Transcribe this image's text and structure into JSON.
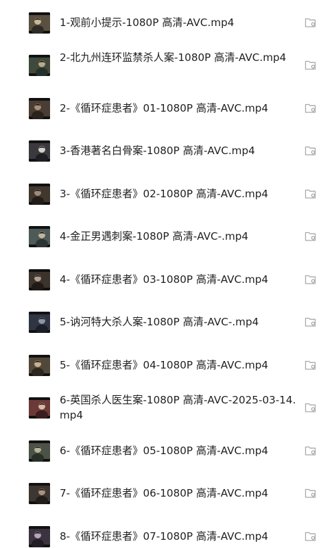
{
  "files": [
    {
      "name": "1-观前小提示-1080P 高清-AVC.mp4",
      "thumb": "intro-thumbnail"
    },
    {
      "name": "2-北九州连环监禁杀人案-1080P 高清-AVC.mp4",
      "thumb": "kitakyushu-thumbnail"
    },
    {
      "name": "2-《循环症患者》01-1080P 高清-AVC.mp4",
      "thumb": "loop-ep01-thumbnail"
    },
    {
      "name": "3-香港著名白骨案-1080P 高清-AVC.mp4",
      "thumb": "hongkong-thumbnail"
    },
    {
      "name": "3-《循环症患者》02-1080P 高清-AVC.mp4",
      "thumb": "loop-ep02-thumbnail"
    },
    {
      "name": "4-金正男遇刺案-1080P 高清-AVC-.mp4",
      "thumb": "kim-jong-nam-thumbnail"
    },
    {
      "name": "4-《循环症患者》03-1080P 高清-AVC.mp4",
      "thumb": "loop-ep03-thumbnail"
    },
    {
      "name": "5-讷河特大杀人案-1080P 高清-AVC-.mp4",
      "thumb": "nehe-thumbnail"
    },
    {
      "name": "5-《循环症患者》04-1080P 高清-AVC.mp4",
      "thumb": "loop-ep04-thumbnail"
    },
    {
      "name": "6-英国杀人医生案-1080P 高清-AVC-2025-03-14.mp4",
      "thumb": "uk-doctor-thumbnail"
    },
    {
      "name": "6-《循环症患者》05-1080P 高清-AVC.mp4",
      "thumb": "loop-ep05-thumbnail"
    },
    {
      "name": "7-《循环症患者》06-1080P 高清-AVC.mp4",
      "thumb": "loop-ep06-thumbnail"
    },
    {
      "name": "8-《循环症患者》07-1080P 高清-AVC.mp4",
      "thumb": "loop-ep07-thumbnail"
    }
  ],
  "row_icon": "folder-location-icon",
  "colors": {
    "text": "#1f1f1f",
    "icon": "#a9a9a9",
    "background": "#ffffff"
  }
}
